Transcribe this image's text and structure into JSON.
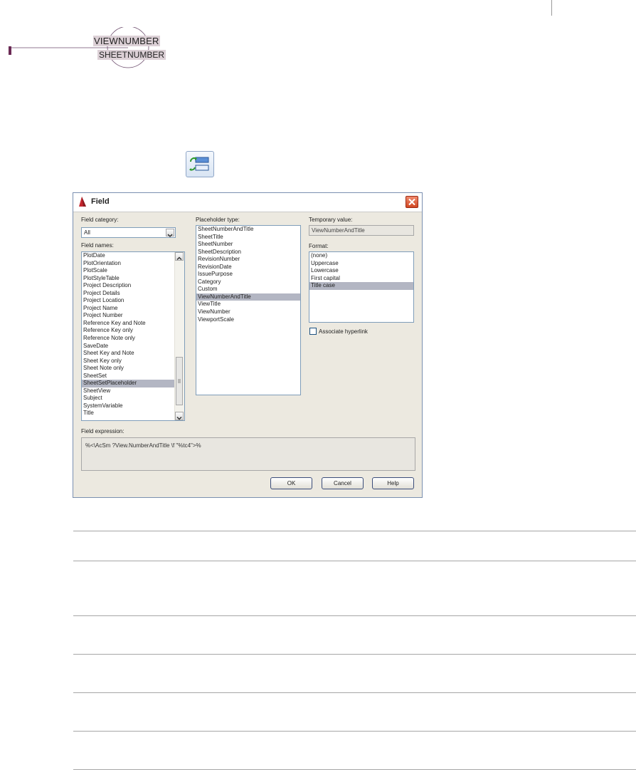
{
  "callout": {
    "top_text": "VIEWNUMBER",
    "bottom_text": "SHEETNUMBER"
  },
  "toolbar": {
    "update_icon": "update-fields-icon"
  },
  "dialog": {
    "title": "Field",
    "field_category_label": "Field category:",
    "field_category_value": "All",
    "field_names_label": "Field names:",
    "field_names": [
      "PlotDate",
      "PlotOrientation",
      "PlotScale",
      "PlotStyleTable",
      "Project Description",
      "Project Details",
      "Project Location",
      "Project Name",
      "Project Number",
      "Reference Key and Note",
      "Reference Key only",
      "Reference Note only",
      "SaveDate",
      "Sheet Key and Note",
      "Sheet Key only",
      "Sheet Note only",
      "SheetSet",
      "SheetSetPlaceholder",
      "SheetView",
      "Subject",
      "SystemVariable",
      "Title"
    ],
    "field_names_selected": "SheetSetPlaceholder",
    "placeholder_type_label": "Placeholder type:",
    "placeholder_types": [
      "SheetNumberAndTitle",
      "SheetTitle",
      "SheetNumber",
      "SheetDescription",
      "RevisionNumber",
      "RevisionDate",
      "IssuePurpose",
      "Category",
      "Custom",
      "ViewNumberAndTitle",
      "ViewTitle",
      "ViewNumber",
      "ViewportScale"
    ],
    "placeholder_selected": "ViewNumberAndTitle",
    "temporary_value_label": "Temporary value:",
    "temporary_value": "ViewNumberAndTitle",
    "format_label": "Format:",
    "formats": [
      "(none)",
      "Uppercase",
      "Lowercase",
      "First capital",
      "Title case"
    ],
    "format_selected": "Title case",
    "associate_hyperlink_label": "Associate hyperlink",
    "associate_hyperlink_checked": false,
    "field_expression_label": "Field expression:",
    "field_expression": "%<\\AcSm ?View.NumberAndTitle \\f \"%tc4\">%",
    "ok_label": "OK",
    "cancel_label": "Cancel",
    "help_label": "Help"
  },
  "colors": {
    "selection": "#b3b6c3",
    "dialog_bg": "#ece9e0",
    "close_button": "#d14822"
  }
}
